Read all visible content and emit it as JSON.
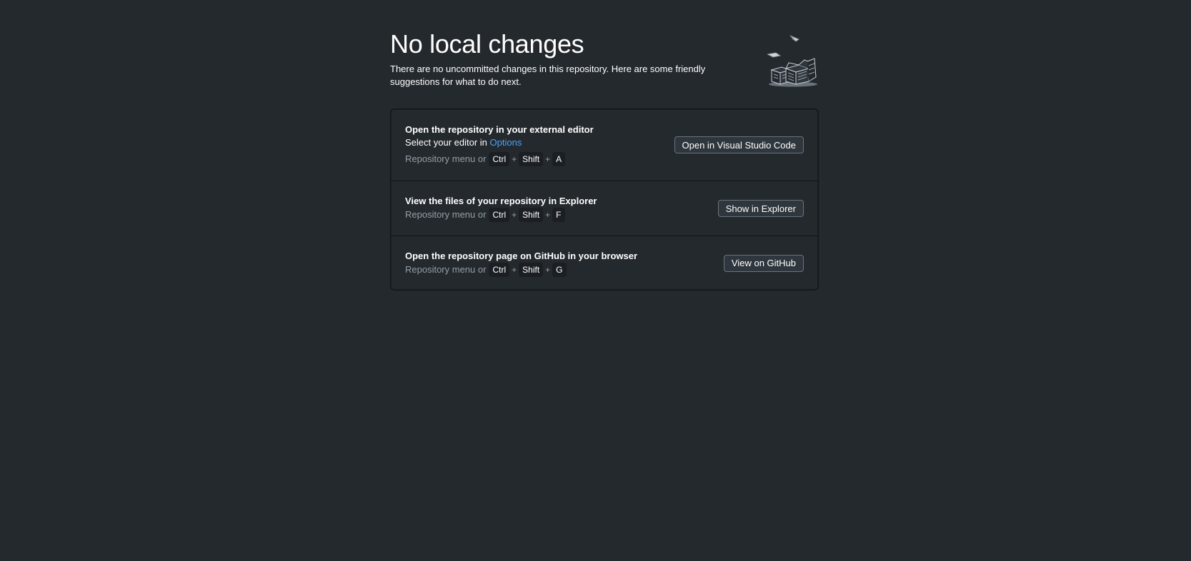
{
  "header": {
    "title": "No local changes",
    "subtitle": "There are no uncommitted changes in this repository. Here are some friendly suggestions for what to do next.",
    "illustration": "empty-boxes-icon"
  },
  "actions": [
    {
      "title": "Open the repository in your external editor",
      "desc_prefix": "Select your editor in ",
      "desc_link": "Options",
      "shortcut_lead": "Repository menu or",
      "keys": [
        "Ctrl",
        "Shift",
        "A"
      ],
      "button": "Open in Visual Studio Code"
    },
    {
      "title": "View the files of your repository in Explorer",
      "shortcut_lead": "Repository menu or",
      "keys": [
        "Ctrl",
        "Shift",
        "F"
      ],
      "button": "Show in Explorer"
    },
    {
      "title": "Open the repository page on GitHub in your browser",
      "shortcut_lead": "Repository menu or",
      "keys": [
        "Ctrl",
        "Shift",
        "G"
      ],
      "button": "View on GitHub"
    }
  ],
  "plus": "+",
  "colors": {
    "background": "#24292e",
    "link": "#4aa3ff",
    "muted": "#959da5"
  }
}
